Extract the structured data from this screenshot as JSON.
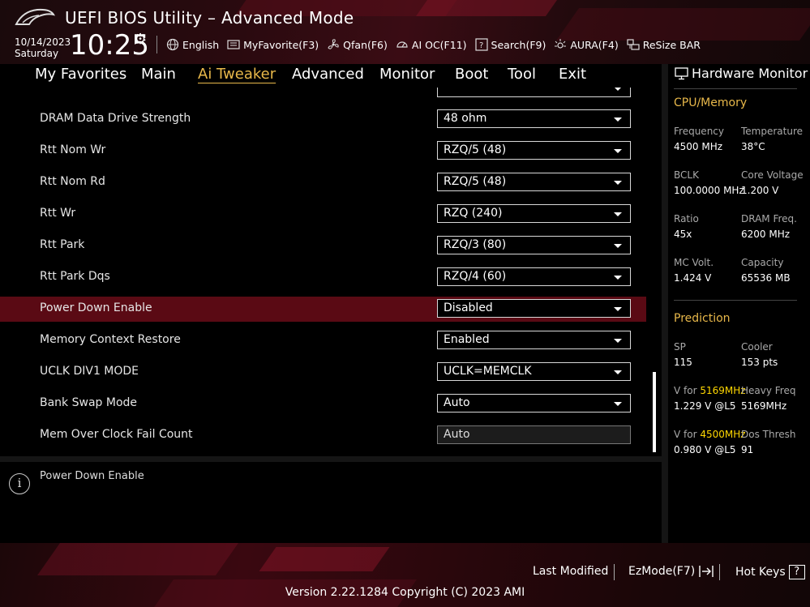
{
  "header": {
    "title": "UEFI BIOS Utility – Advanced Mode",
    "date": "10/14/2023",
    "day": "Saturday",
    "time": "10:25",
    "toolbar": [
      {
        "label": "English",
        "icon": "globe-icon"
      },
      {
        "label": "MyFavorite(F3)",
        "icon": "favorite-icon"
      },
      {
        "label": "Qfan(F6)",
        "icon": "fan-icon"
      },
      {
        "label": "AI OC(F11)",
        "icon": "ai-oc-icon"
      },
      {
        "label": "Search(F9)",
        "icon": "search-icon"
      },
      {
        "label": "AURA(F4)",
        "icon": "aura-icon"
      },
      {
        "label": "ReSize BAR",
        "icon": "resize-bar-icon"
      }
    ]
  },
  "nav": {
    "tabs": [
      "My Favorites",
      "Main",
      "Ai Tweaker",
      "Advanced",
      "Monitor",
      "Boot",
      "Tool",
      "Exit"
    ],
    "active": "Ai Tweaker"
  },
  "settings": [
    {
      "label": "DRAM Data Drive Strength",
      "value": "48 ohm"
    },
    {
      "label": "Rtt Nom Wr",
      "value": "RZQ/5 (48)"
    },
    {
      "label": "Rtt Nom Rd",
      "value": "RZQ/5 (48)"
    },
    {
      "label": "Rtt Wr",
      "value": "RZQ (240)"
    },
    {
      "label": "Rtt Park",
      "value": "RZQ/3 (80)"
    },
    {
      "label": "Rtt Park Dqs",
      "value": "RZQ/4 (60)"
    },
    {
      "label": "Power Down Enable",
      "value": "Disabled"
    },
    {
      "label": "Memory Context Restore",
      "value": "Enabled"
    },
    {
      "label": "UCLK DIV1 MODE",
      "value": "UCLK=MEMCLK"
    },
    {
      "label": "Bank Swap Mode",
      "value": "Auto"
    },
    {
      "label": "Mem Over Clock Fail Count",
      "value": "Auto"
    }
  ],
  "selected_setting": "Power Down Enable",
  "help": {
    "text": "Power Down Enable"
  },
  "hardware_monitor": {
    "title": "Hardware Monitor",
    "cpu_memory": {
      "section": "CPU/Memory",
      "frequency_label": "Frequency",
      "frequency": "4500 MHz",
      "temperature_label": "Temperature",
      "temperature": "38°C",
      "bclk_label": "BCLK",
      "bclk": "100.0000 MHz",
      "core_voltage_label": "Core Voltage",
      "core_voltage": "1.200 V",
      "ratio_label": "Ratio",
      "ratio": "45x",
      "dram_freq_label": "DRAM Freq.",
      "dram_freq": "6200 MHz",
      "mc_volt_label": "MC Volt.",
      "mc_volt": "1.424 V",
      "capacity_label": "Capacity",
      "capacity": "65536 MB"
    },
    "prediction": {
      "section": "Prediction",
      "sp_label": "SP",
      "sp": "115",
      "cooler_label": "Cooler",
      "cooler": "153 pts",
      "v_for_label": "V for",
      "freq1": "5169MHz",
      "v1": "1.229 V @L5",
      "heavy_freq_label": "Heavy Freq",
      "heavy_freq": "5169MHz",
      "freq2": "4500MHz",
      "v2": "0.980 V @L5",
      "dos_thresh_label": "Dos Thresh",
      "dos_thresh": "91"
    }
  },
  "footer": {
    "last_modified": "Last Modified",
    "ezmode": "EzMode(F7)",
    "hot_keys": "Hot Keys",
    "hot_keys_key": "?",
    "version": "Version 2.22.1284 Copyright (C) 2023 AMI"
  }
}
